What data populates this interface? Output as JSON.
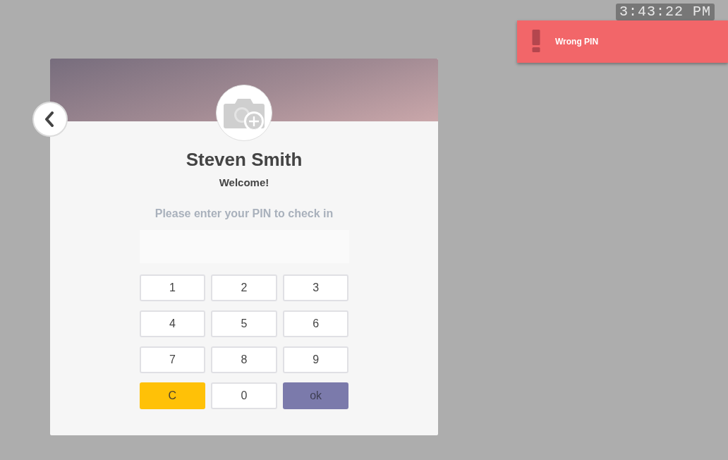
{
  "clock": {
    "time": "3:43:22 PM"
  },
  "notification": {
    "kind": "error",
    "message": "Wrong PIN"
  },
  "profile": {
    "name": "Steven Smith",
    "greeting": "Welcome!"
  },
  "pin_entry": {
    "prompt": "Please enter your PIN to check in"
  },
  "keypad": [
    {
      "label": "1",
      "kind": "digit"
    },
    {
      "label": "2",
      "kind": "digit"
    },
    {
      "label": "3",
      "kind": "digit"
    },
    {
      "label": "4",
      "kind": "digit"
    },
    {
      "label": "5",
      "kind": "digit"
    },
    {
      "label": "6",
      "kind": "digit"
    },
    {
      "label": "7",
      "kind": "digit"
    },
    {
      "label": "8",
      "kind": "digit"
    },
    {
      "label": "9",
      "kind": "digit"
    },
    {
      "label": "C",
      "kind": "clear"
    },
    {
      "label": "0",
      "kind": "digit"
    },
    {
      "label": "ok",
      "kind": "confirm"
    }
  ]
}
